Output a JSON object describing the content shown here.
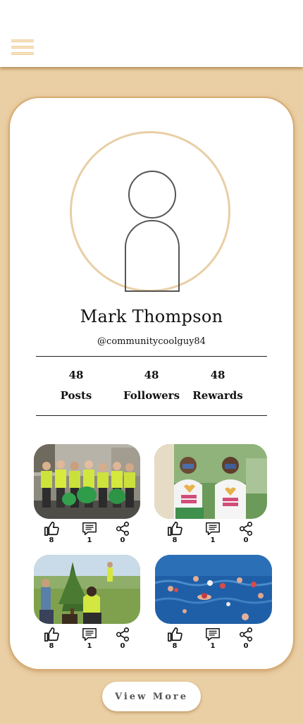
{
  "header": {
    "menu_icon": "hamburger-icon"
  },
  "profile": {
    "name": "Mark Thompson",
    "handle": "@communitycoolguy84",
    "avatar_icon": "user-placeholder-icon"
  },
  "stats": [
    {
      "value": "48",
      "label": "Posts"
    },
    {
      "value": "48",
      "label": "Followers"
    },
    {
      "value": "48",
      "label": "Rewards"
    }
  ],
  "posts": [
    {
      "image": "volunteers-in-hi-vis-vests-photo",
      "likes": "8",
      "comments": "1",
      "shares": "0"
    },
    {
      "image": "doing-good-tshirts-photo",
      "likes": "8",
      "comments": "1",
      "shares": "0"
    },
    {
      "image": "tree-planting-photo",
      "likes": "8",
      "comments": "1",
      "shares": "0"
    },
    {
      "image": "open-water-swimmers-photo",
      "likes": "8",
      "comments": "1",
      "shares": "0"
    }
  ],
  "action_icons": [
    "thumbs-up-icon",
    "comment-icon",
    "share-icon"
  ],
  "view_more_label": "View More",
  "colors": {
    "background": "#eacfa4",
    "accent": "#d8ab70"
  }
}
